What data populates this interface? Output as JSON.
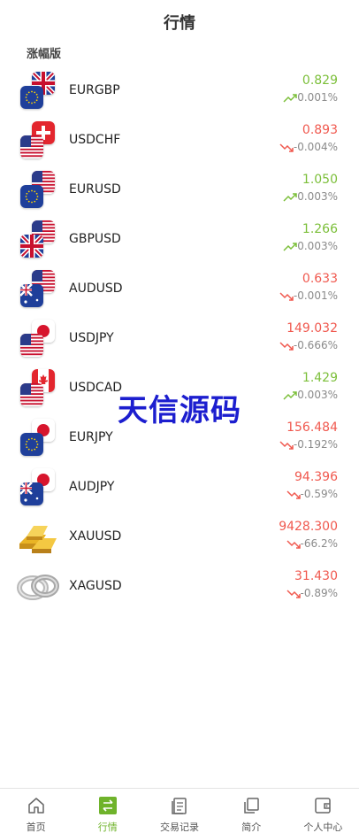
{
  "header": {
    "title": "行情"
  },
  "section": {
    "label": "涨幅版"
  },
  "quotes": [
    {
      "symbol": "EURGBP",
      "price": "0.829",
      "change": "0.001%",
      "direction": "up",
      "front_flag": "eu-flag",
      "back_flag": "gb-flag"
    },
    {
      "symbol": "USDCHF",
      "price": "0.893",
      "change": "-0.004%",
      "direction": "down",
      "front_flag": "us-flag",
      "back_flag": "ch-flag"
    },
    {
      "symbol": "EURUSD",
      "price": "1.050",
      "change": "0.003%",
      "direction": "up",
      "front_flag": "eu-flag",
      "back_flag": "us-flag"
    },
    {
      "symbol": "GBPUSD",
      "price": "1.266",
      "change": "0.003%",
      "direction": "up",
      "front_flag": "gb-flag",
      "back_flag": "us-flag"
    },
    {
      "symbol": "AUDUSD",
      "price": "0.633",
      "change": "-0.001%",
      "direction": "down",
      "front_flag": "au-flag",
      "back_flag": "us-flag"
    },
    {
      "symbol": "USDJPY",
      "price": "149.032",
      "change": "-0.666%",
      "direction": "down",
      "front_flag": "us-flag",
      "back_flag": "jp-flag"
    },
    {
      "symbol": "USDCAD",
      "price": "1.429",
      "change": "0.003%",
      "direction": "up",
      "front_flag": "us-flag",
      "back_flag": "ca-flag"
    },
    {
      "symbol": "EURJPY",
      "price": "156.484",
      "change": "-0.192%",
      "direction": "down",
      "front_flag": "eu-flag",
      "back_flag": "jp-flag"
    },
    {
      "symbol": "AUDJPY",
      "price": "94.396",
      "change": "-0.59%",
      "direction": "down",
      "front_flag": "au-flag",
      "back_flag": "jp-flag"
    },
    {
      "symbol": "XAUUSD",
      "price": "9428.300",
      "change": "-66.2%",
      "direction": "down",
      "icon": "gold-bars-icon"
    },
    {
      "symbol": "XAGUSD",
      "price": "31.430",
      "change": "-0.89%",
      "direction": "down",
      "icon": "silver-rings-icon"
    }
  ],
  "watermark": {
    "text": "天信源码"
  },
  "tabbar": {
    "items": [
      {
        "label": "首页",
        "icon": "home-icon",
        "active": false
      },
      {
        "label": "行情",
        "icon": "swap-icon",
        "active": true
      },
      {
        "label": "交易记录",
        "icon": "records-icon",
        "active": false
      },
      {
        "label": "简介",
        "icon": "copy-icon",
        "active": false
      },
      {
        "label": "个人中心",
        "icon": "wallet-icon",
        "active": false
      }
    ]
  },
  "colors": {
    "up": "#7cbf3a",
    "down": "#f0594f",
    "accent": "#6fb32b",
    "watermark": "#1c1ecf"
  }
}
